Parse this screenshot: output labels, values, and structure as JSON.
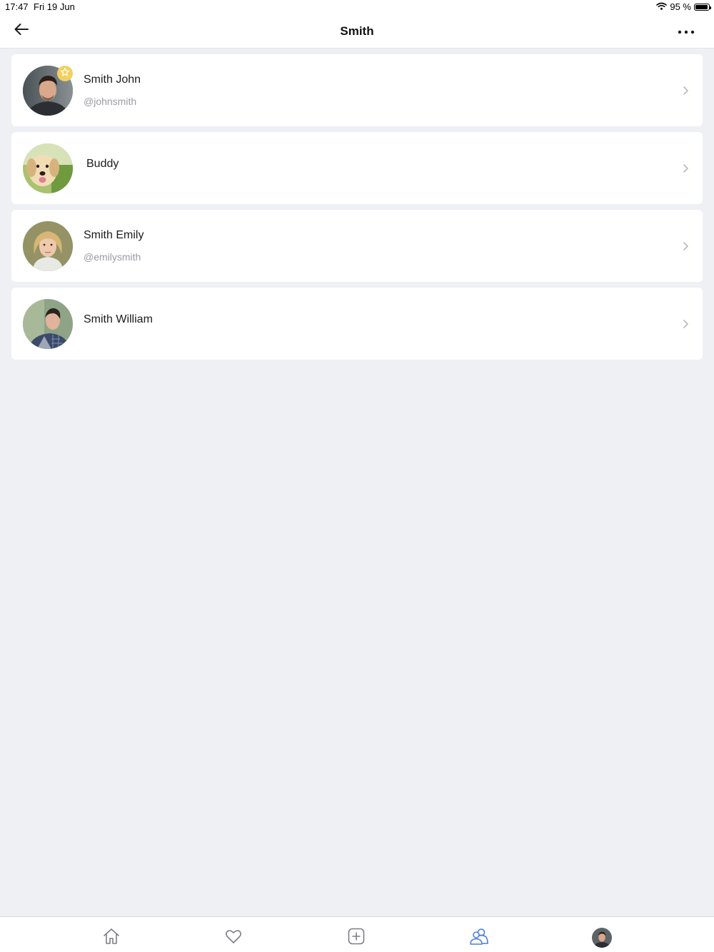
{
  "status_bar": {
    "time": "17:47",
    "date": "Fri 19 Jun",
    "battery": "95 %",
    "battery_level": 0.95
  },
  "nav": {
    "title": "Smith",
    "back_icon": "arrow-left-icon",
    "more_icon": "more-horizontal-icon"
  },
  "contacts": [
    {
      "name": "Smith John",
      "handle": "@johnsmith",
      "favorite": true,
      "avatar": "man-portrait"
    },
    {
      "name": "Buddy",
      "handle": "",
      "favorite": false,
      "avatar": "dog-portrait"
    },
    {
      "name": "Smith Emily",
      "handle": "@emilysmith",
      "favorite": false,
      "avatar": "woman-portrait"
    },
    {
      "name": "Smith William",
      "handle": "",
      "favorite": false,
      "avatar": "young-man-portrait"
    }
  ],
  "tabbar": {
    "items": [
      "home-icon",
      "heart-icon",
      "add-square-icon",
      "people-icon",
      "profile-avatar"
    ],
    "active_index": 3
  },
  "colors": {
    "background": "#eff0f4",
    "card": "#ffffff",
    "accent": "#4a7fe0",
    "favorite_badge": "#f2d060",
    "muted_text": "#9a9ba3",
    "icon_gray": "#7d7e86"
  }
}
